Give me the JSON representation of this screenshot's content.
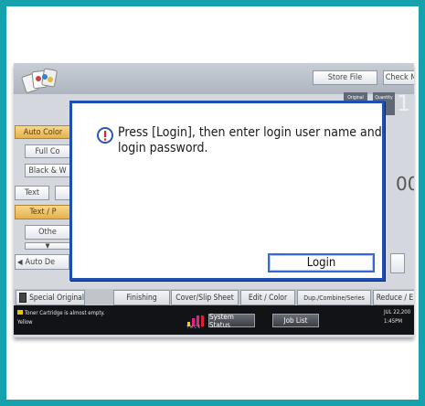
{
  "header": {
    "store_file_label": "Store File",
    "check_label": "Check M",
    "original_label": "Original",
    "quantity_label": "Quantity",
    "quantity_value": "1",
    "ratio_value": "00%"
  },
  "left_buttons": [
    {
      "label": "Auto Color"
    },
    {
      "label": "Full Co"
    },
    {
      "label": "Black & W"
    },
    {
      "label": "Text"
    },
    {
      "label": "Text / P"
    },
    {
      "label": "Othe"
    },
    {
      "label": "Auto De"
    }
  ],
  "tabs": [
    {
      "label": "Special Original"
    },
    {
      "label": "Finishing"
    },
    {
      "label": "Cover/Slip Sheet"
    },
    {
      "label": "Edit / Color"
    },
    {
      "label": "Dup./Combine/Series"
    },
    {
      "label": "Reduce / E"
    }
  ],
  "status": {
    "message": "Toner Cartridge is almost empty.",
    "color": "Yellow",
    "system_status_label": "System Status",
    "job_list_label": "Job List",
    "date": "JUL  22,200",
    "time": "1:45PM"
  },
  "dialog": {
    "message": "Press [Login], then enter login user name and login password.",
    "login_label": "Login"
  },
  "colors": {
    "frame": "#16a2ad",
    "dialog_border": "#1e4fae",
    "accent_orange": "#e5b04c",
    "icon_blue": "#2a57b8",
    "icon_red": "#d8242e"
  }
}
